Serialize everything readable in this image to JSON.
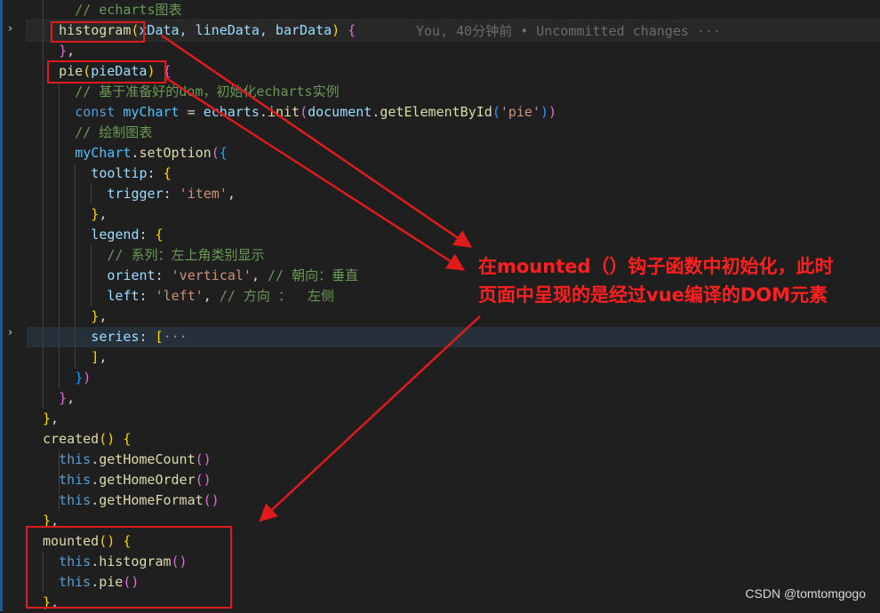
{
  "editor": {
    "lines": [
      {
        "indent": 4,
        "tokens": [
          {
            "t": "// echarts图表",
            "c": "#6a9955"
          }
        ]
      },
      {
        "indent": 2,
        "tokens": [
          {
            "t": "histogram",
            "c": "#dcdcaa"
          },
          {
            "t": "(",
            "c": "#ffd700"
          },
          {
            "t": "xData, lineData, barData",
            "c": "#9cdcfe"
          },
          {
            "t": ")",
            "c": "#ffd700"
          },
          {
            "t": " ",
            "c": "#d4d4d4"
          },
          {
            "t": "{",
            "c": "#da70d6"
          }
        ]
      },
      {
        "indent": 2,
        "tokens": [
          {
            "t": "}",
            "c": "#da70d6"
          },
          {
            "t": ",",
            "c": "#d4d4d4"
          }
        ]
      },
      {
        "indent": 2,
        "tokens": [
          {
            "t": "pie",
            "c": "#dcdcaa"
          },
          {
            "t": "(",
            "c": "#ffd700"
          },
          {
            "t": "pieData",
            "c": "#9cdcfe"
          },
          {
            "t": ")",
            "c": "#ffd700"
          },
          {
            "t": " ",
            "c": "#d4d4d4"
          },
          {
            "t": "{",
            "c": "#da70d6"
          }
        ]
      },
      {
        "indent": 4,
        "tokens": [
          {
            "t": "// 基于准备好的dom，初始化echarts实例",
            "c": "#6a9955"
          }
        ]
      },
      {
        "indent": 4,
        "tokens": [
          {
            "t": "const ",
            "c": "#569cd6"
          },
          {
            "t": "myChart",
            "c": "#4fc1ff"
          },
          {
            "t": " = ",
            "c": "#d4d4d4"
          },
          {
            "t": "echarts",
            "c": "#9cdcfe"
          },
          {
            "t": ".",
            "c": "#d4d4d4"
          },
          {
            "t": "init",
            "c": "#dcdcaa"
          },
          {
            "t": "(",
            "c": "#da70d6"
          },
          {
            "t": "document",
            "c": "#9cdcfe"
          },
          {
            "t": ".",
            "c": "#d4d4d4"
          },
          {
            "t": "getElementById",
            "c": "#dcdcaa"
          },
          {
            "t": "(",
            "c": "#179fff"
          },
          {
            "t": "'pie'",
            "c": "#ce9178"
          },
          {
            "t": ")",
            "c": "#179fff"
          },
          {
            "t": ")",
            "c": "#da70d6"
          }
        ]
      },
      {
        "indent": 4,
        "tokens": [
          {
            "t": "// 绘制图表",
            "c": "#6a9955"
          }
        ]
      },
      {
        "indent": 4,
        "tokens": [
          {
            "t": "myChart",
            "c": "#4fc1ff"
          },
          {
            "t": ".",
            "c": "#d4d4d4"
          },
          {
            "t": "setOption",
            "c": "#dcdcaa"
          },
          {
            "t": "(",
            "c": "#da70d6"
          },
          {
            "t": "{",
            "c": "#179fff"
          }
        ]
      },
      {
        "indent": 6,
        "tokens": [
          {
            "t": "tooltip",
            "c": "#9cdcfe"
          },
          {
            "t": ": ",
            "c": "#d4d4d4"
          },
          {
            "t": "{",
            "c": "#ffd700"
          }
        ]
      },
      {
        "indent": 8,
        "tokens": [
          {
            "t": "trigger",
            "c": "#9cdcfe"
          },
          {
            "t": ": ",
            "c": "#d4d4d4"
          },
          {
            "t": "'item'",
            "c": "#ce9178"
          },
          {
            "t": ",",
            "c": "#d4d4d4"
          }
        ]
      },
      {
        "indent": 6,
        "tokens": [
          {
            "t": "}",
            "c": "#ffd700"
          },
          {
            "t": ",",
            "c": "#d4d4d4"
          }
        ]
      },
      {
        "indent": 6,
        "tokens": [
          {
            "t": "legend",
            "c": "#9cdcfe"
          },
          {
            "t": ": ",
            "c": "#d4d4d4"
          },
          {
            "t": "{",
            "c": "#ffd700"
          }
        ]
      },
      {
        "indent": 8,
        "tokens": [
          {
            "t": "// 系列：左上角类别显示",
            "c": "#6a9955"
          }
        ]
      },
      {
        "indent": 8,
        "tokens": [
          {
            "t": "orient",
            "c": "#9cdcfe"
          },
          {
            "t": ": ",
            "c": "#d4d4d4"
          },
          {
            "t": "'vertical'",
            "c": "#ce9178"
          },
          {
            "t": ", ",
            "c": "#d4d4d4"
          },
          {
            "t": "// 朝向：垂直",
            "c": "#6a9955"
          }
        ]
      },
      {
        "indent": 8,
        "tokens": [
          {
            "t": "left",
            "c": "#9cdcfe"
          },
          {
            "t": ": ",
            "c": "#d4d4d4"
          },
          {
            "t": "'left'",
            "c": "#ce9178"
          },
          {
            "t": ", ",
            "c": "#d4d4d4"
          },
          {
            "t": "// 方向 ：  左侧",
            "c": "#6a9955"
          }
        ]
      },
      {
        "indent": 6,
        "tokens": [
          {
            "t": "}",
            "c": "#ffd700"
          },
          {
            "t": ",",
            "c": "#d4d4d4"
          }
        ]
      },
      {
        "indent": 6,
        "tokens": [
          {
            "t": "series",
            "c": "#9cdcfe"
          },
          {
            "t": ": ",
            "c": "#d4d4d4"
          },
          {
            "t": "[",
            "c": "#ffd700"
          },
          {
            "t": "···",
            "c": "#8c8c8c"
          }
        ]
      },
      {
        "indent": 6,
        "tokens": [
          {
            "t": "]",
            "c": "#ffd700"
          },
          {
            "t": ",",
            "c": "#d4d4d4"
          }
        ]
      },
      {
        "indent": 4,
        "tokens": [
          {
            "t": "}",
            "c": "#179fff"
          },
          {
            "t": ")",
            "c": "#da70d6"
          }
        ]
      },
      {
        "indent": 2,
        "tokens": [
          {
            "t": "}",
            "c": "#da70d6"
          },
          {
            "t": ",",
            "c": "#d4d4d4"
          }
        ]
      },
      {
        "indent": 0,
        "tokens": [
          {
            "t": "}",
            "c": "#ffd700"
          },
          {
            "t": ",",
            "c": "#d4d4d4"
          }
        ]
      },
      {
        "indent": 0,
        "tokens": [
          {
            "t": "created",
            "c": "#dcdcaa"
          },
          {
            "t": "()",
            "c": "#ffd700"
          },
          {
            "t": " ",
            "c": "#d4d4d4"
          },
          {
            "t": "{",
            "c": "#ffd700"
          }
        ]
      },
      {
        "indent": 2,
        "tokens": [
          {
            "t": "this",
            "c": "#569cd6"
          },
          {
            "t": ".",
            "c": "#d4d4d4"
          },
          {
            "t": "getHomeCount",
            "c": "#dcdcaa"
          },
          {
            "t": "()",
            "c": "#da70d6"
          }
        ]
      },
      {
        "indent": 2,
        "tokens": [
          {
            "t": "this",
            "c": "#569cd6"
          },
          {
            "t": ".",
            "c": "#d4d4d4"
          },
          {
            "t": "getHomeOrder",
            "c": "#dcdcaa"
          },
          {
            "t": "()",
            "c": "#da70d6"
          }
        ]
      },
      {
        "indent": 2,
        "tokens": [
          {
            "t": "this",
            "c": "#569cd6"
          },
          {
            "t": ".",
            "c": "#d4d4d4"
          },
          {
            "t": "getHomeFormat",
            "c": "#dcdcaa"
          },
          {
            "t": "()",
            "c": "#da70d6"
          }
        ]
      },
      {
        "indent": 0,
        "tokens": [
          {
            "t": "}",
            "c": "#ffd700"
          },
          {
            "t": ",",
            "c": "#d4d4d4"
          }
        ]
      },
      {
        "indent": 0,
        "tokens": [
          {
            "t": "mounted",
            "c": "#dcdcaa"
          },
          {
            "t": "()",
            "c": "#ffd700"
          },
          {
            "t": " ",
            "c": "#d4d4d4"
          },
          {
            "t": "{",
            "c": "#ffd700"
          }
        ]
      },
      {
        "indent": 2,
        "tokens": [
          {
            "t": "this",
            "c": "#569cd6"
          },
          {
            "t": ".",
            "c": "#d4d4d4"
          },
          {
            "t": "histogram",
            "c": "#dcdcaa"
          },
          {
            "t": "()",
            "c": "#da70d6"
          }
        ]
      },
      {
        "indent": 2,
        "tokens": [
          {
            "t": "this",
            "c": "#569cd6"
          },
          {
            "t": ".",
            "c": "#d4d4d4"
          },
          {
            "t": "pie",
            "c": "#dcdcaa"
          },
          {
            "t": "()",
            "c": "#da70d6"
          }
        ]
      },
      {
        "indent": 0,
        "tokens": [
          {
            "t": "}",
            "c": "#ffd700"
          },
          {
            "t": ",",
            "c": "#d4d4d4"
          }
        ]
      }
    ],
    "blame": "You, 40分钟前 • Uncommitted changes ···",
    "fold_chevrons": [
      "›",
      "›"
    ]
  },
  "annotation": {
    "line1": "在mounted（）钩子函数中初始化，此时",
    "line2": "页面中呈现的是经过vue编译的DOM元素"
  },
  "watermark": "CSDN @tomtomgogo",
  "colors": {
    "annotation": "#ff1f1f",
    "box": "#e01b1b",
    "background": "#1f1f1f"
  }
}
